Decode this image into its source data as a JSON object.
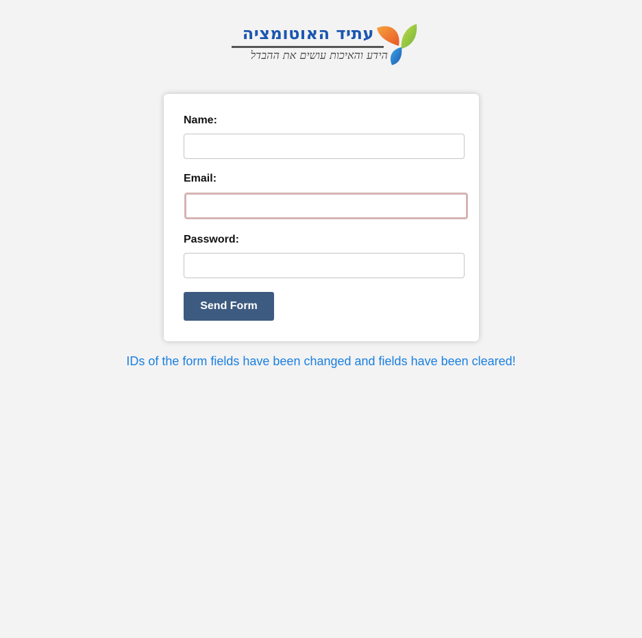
{
  "logo": {
    "title": "עתיד האוטומציה",
    "tagline": "הידע והאיכות עושים את ההבדל"
  },
  "form": {
    "name_label": "Name:",
    "name_value": "",
    "email_label": "Email:",
    "email_value": "",
    "password_label": "Password:",
    "password_value": "",
    "submit_label": "Send Form"
  },
  "status": {
    "message": "IDs of the form fields have been changed and fields have been cleared!"
  },
  "colors": {
    "background": "#f3f3f3",
    "button": "#3d5a80",
    "message": "#1a7fe0",
    "logo_blue": "#1b57b0",
    "focused_border": "#d6b3b3"
  }
}
